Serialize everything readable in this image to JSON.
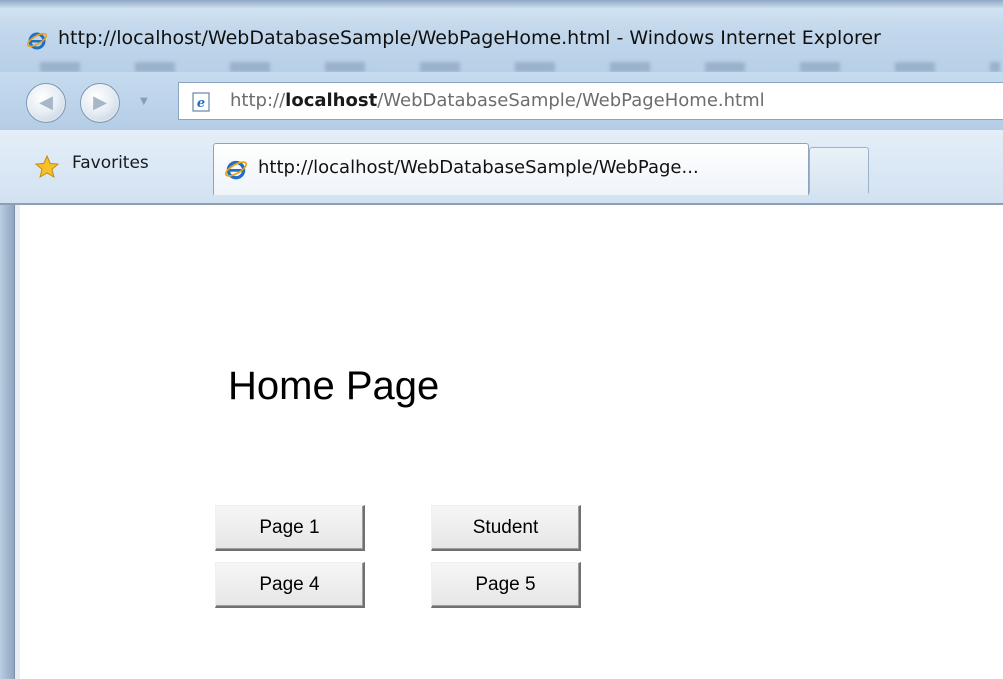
{
  "window": {
    "title": "http://localhost/WebDatabaseSample/WebPageHome.html - Windows Internet Explorer"
  },
  "address_bar": {
    "prefix": "http://",
    "host": "localhost",
    "path": "/WebDatabaseSample/WebPageHome.html"
  },
  "favorites": {
    "label": "Favorites"
  },
  "tabs": [
    {
      "label": "http://localhost/WebDatabaseSample/WebPage..."
    }
  ],
  "page": {
    "heading": "Home Page",
    "buttons": [
      {
        "label": "Page 1"
      },
      {
        "label": "Student"
      },
      {
        "label": "Page 4"
      },
      {
        "label": "Page 5"
      }
    ]
  },
  "icons": {
    "ie": "ie-logo-icon",
    "page": "page-icon",
    "favorites": "favorites-star-icon"
  },
  "colors": {
    "chrome": "#c3d8ec",
    "ie_blue": "#1f6fc6",
    "button_face": "#ececec"
  }
}
